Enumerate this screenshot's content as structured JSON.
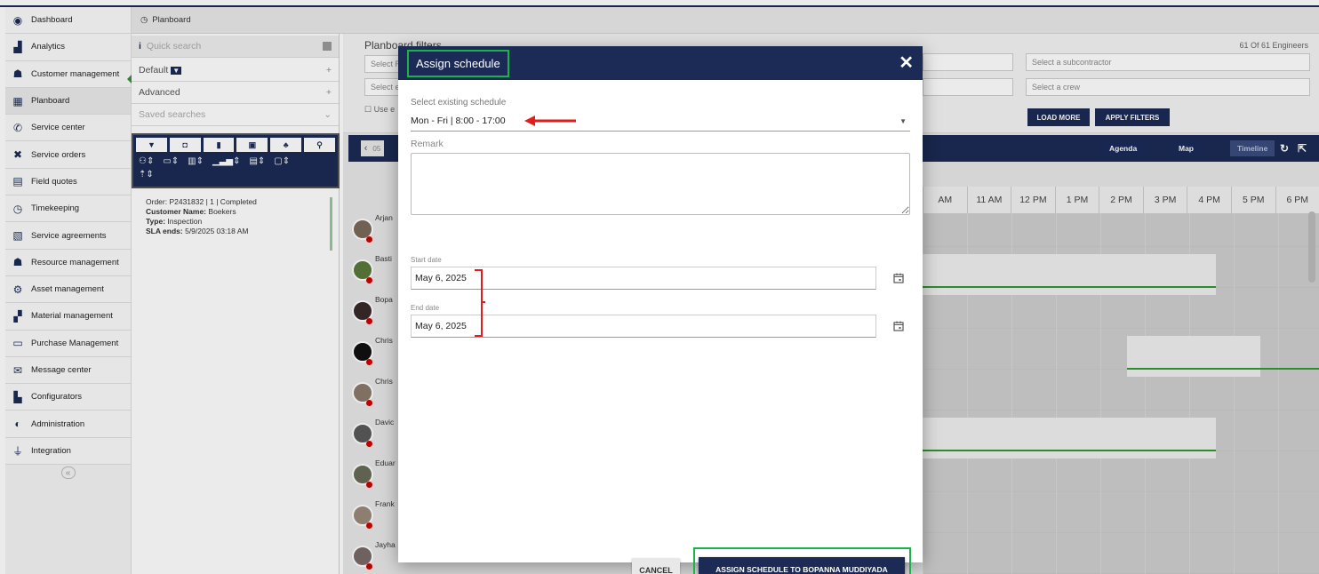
{
  "sidebar": {
    "items": [
      {
        "label": "Dashboard",
        "icon": "dashboard-icon"
      },
      {
        "label": "Analytics",
        "icon": "analytics-icon"
      },
      {
        "label": "Customer management",
        "icon": "customers-icon"
      },
      {
        "label": "Planboard",
        "icon": "calendar-icon"
      },
      {
        "label": "Service center",
        "icon": "phone-icon"
      },
      {
        "label": "Service orders",
        "icon": "tools-icon"
      },
      {
        "label": "Field quotes",
        "icon": "document-icon"
      },
      {
        "label": "Timekeeping",
        "icon": "clock-icon"
      },
      {
        "label": "Service agreements",
        "icon": "agreement-icon"
      },
      {
        "label": "Resource management",
        "icon": "resources-icon"
      },
      {
        "label": "Asset management",
        "icon": "assets-icon"
      },
      {
        "label": "Material management",
        "icon": "boxes-icon"
      },
      {
        "label": "Purchase Management",
        "icon": "purchase-icon"
      },
      {
        "label": "Message center",
        "icon": "mail-icon"
      },
      {
        "label": "Configurators",
        "icon": "factory-icon"
      },
      {
        "label": "Administration",
        "icon": "shield-icon"
      },
      {
        "label": "Integration",
        "icon": "plug-icon"
      }
    ],
    "collapse_symbol": "«"
  },
  "breadcrumb": {
    "label": "Planboard"
  },
  "left_panel": {
    "quick_search_placeholder": "Quick search",
    "default_label": "Default",
    "advanced_label": "Advanced",
    "saved_searches_label": "Saved searches",
    "order_card": {
      "order": "Order: P2431832 | 1 | Completed",
      "customer_key": "Customer Name:",
      "customer_val": "Boekers",
      "type_key": "Type:",
      "type_val": "Inspection",
      "sla_key": "SLA ends:",
      "sla_val": "5/9/2025 03:18 AM"
    }
  },
  "planboard": {
    "filters_title": "Planboard filters",
    "engineer_count": "61 Of 61 Engineers",
    "select_subcontractor": "Select a subcontractor",
    "select_crew": "Select a crew",
    "select_r": "Select R",
    "select_e": "Select e",
    "use_e": "Use e",
    "load_more": "LOAD MORE",
    "apply_filters": "APPLY FILTERS",
    "tabs": {
      "agenda": "Agenda",
      "map": "Map",
      "timeline": "Timeline"
    },
    "prev_label": "05",
    "hours": [
      "AM",
      "11 AM",
      "12 PM",
      "1 PM",
      "2 PM",
      "3 PM",
      "4 PM",
      "5 PM",
      "6 PM"
    ],
    "engineers": [
      "Arjan",
      "Basti",
      "Bopa",
      "Chris",
      "Chris",
      "Davic",
      "Eduar",
      "Frank",
      "Jayha"
    ]
  },
  "modal": {
    "title": "Assign schedule",
    "close_symbol": "✕",
    "select_label": "Select existing schedule",
    "select_value": "Mon - Fri | 8:00 - 17:00",
    "remark_label": "Remark",
    "remark_value": "",
    "start_label": "Start date",
    "start_value": "May 6, 2025",
    "end_label": "End date",
    "end_value": "May 6, 2025",
    "cancel_label": "CANCEL",
    "assign_label": "ASSIGN SCHEDULE TO BOPANNA MUDDIYADA"
  },
  "colors": {
    "navy": "#1c2b55",
    "highlight_green": "#19b34a",
    "annotation_red": "#e01e1e",
    "timeline_green": "#2f9a2f"
  }
}
